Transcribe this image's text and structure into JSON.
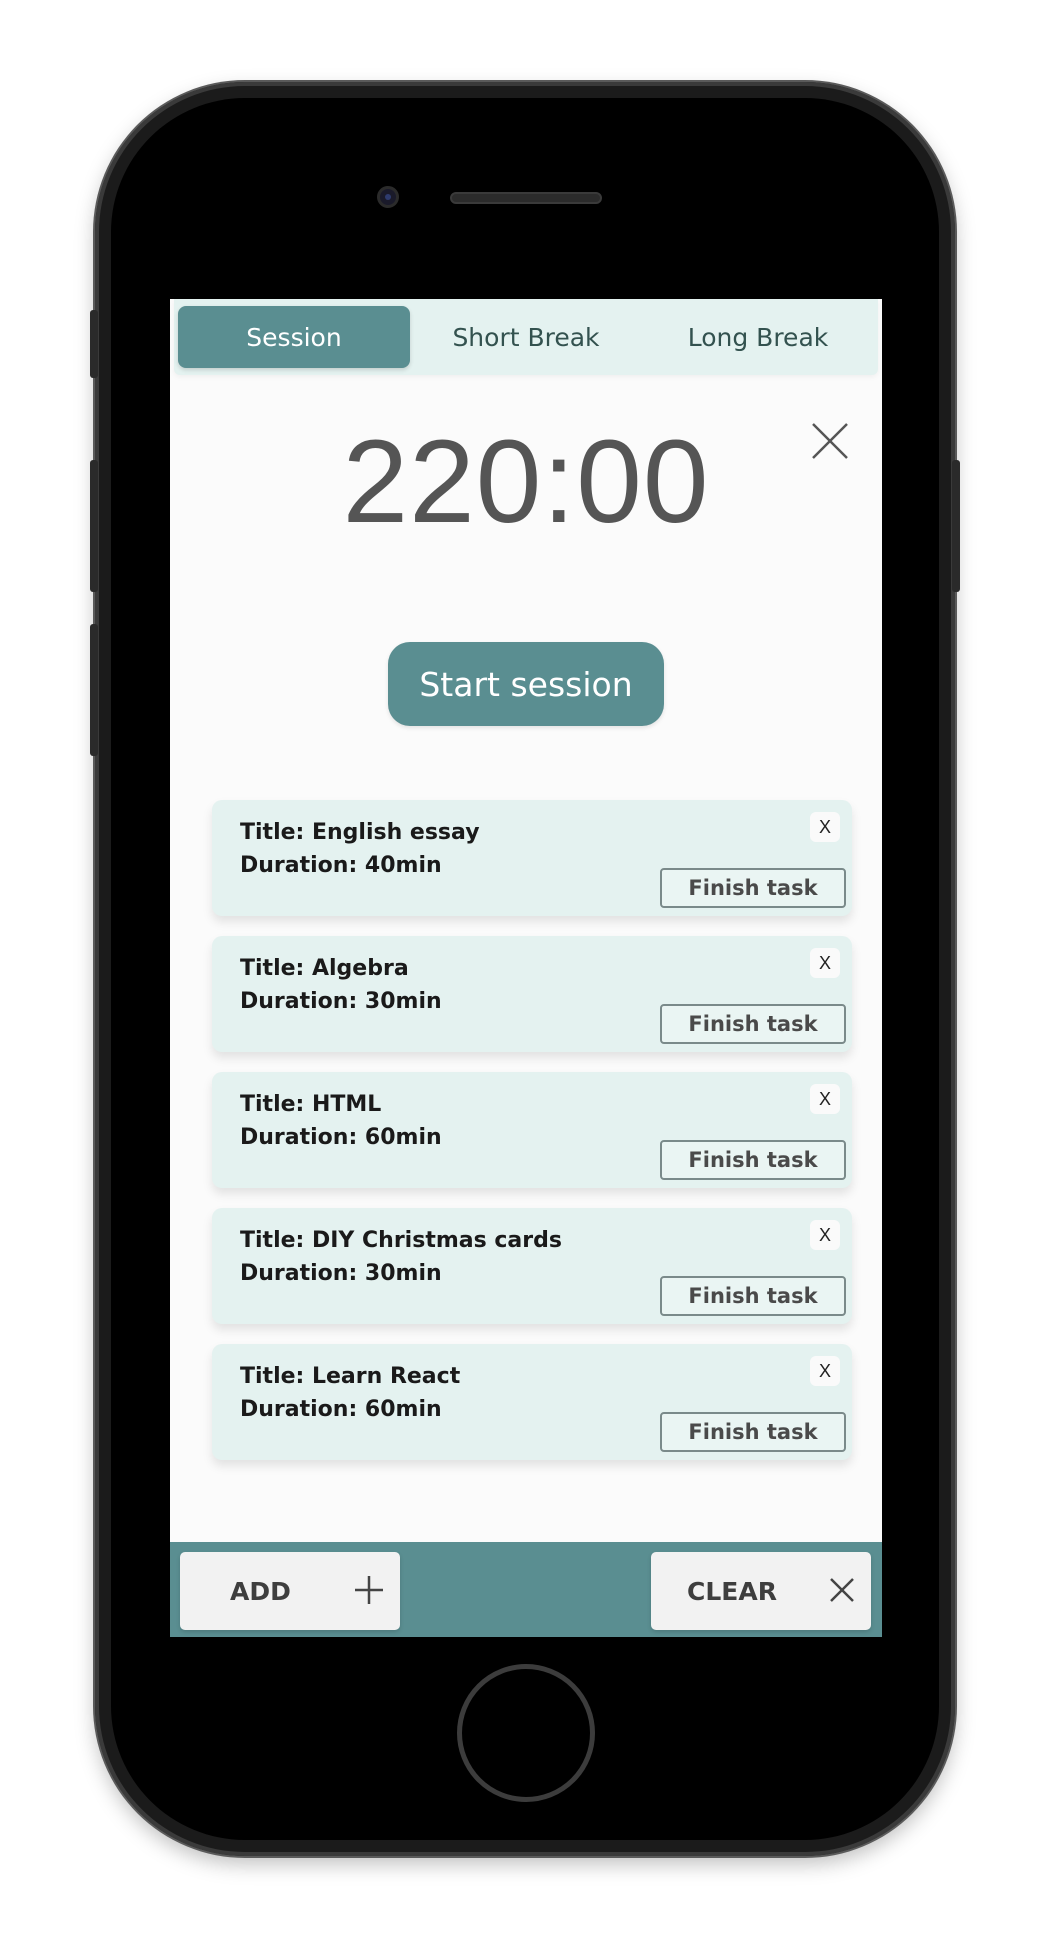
{
  "tabs": [
    {
      "label": "Session",
      "active": true
    },
    {
      "label": "Short Break",
      "active": false
    },
    {
      "label": "Long Break",
      "active": false
    }
  ],
  "timer": {
    "display": "220:00"
  },
  "start_button": {
    "label": "Start session"
  },
  "tasks": [
    {
      "title": "Title: English essay",
      "duration": "Duration: 40min",
      "remove_label": "X",
      "finish_label": "Finish task"
    },
    {
      "title": "Title: Algebra",
      "duration": "Duration: 30min",
      "remove_label": "X",
      "finish_label": "Finish task"
    },
    {
      "title": "Title: HTML",
      "duration": "Duration: 60min",
      "remove_label": "X",
      "finish_label": "Finish task"
    },
    {
      "title": "Title: DIY Christmas cards",
      "duration": "Duration: 30min",
      "remove_label": "X",
      "finish_label": "Finish task"
    },
    {
      "title": "Title: Learn React",
      "duration": "Duration: 60min",
      "remove_label": "X",
      "finish_label": "Finish task"
    }
  ],
  "bottom_bar": {
    "add_label": "ADD",
    "add_icon": "plus-icon",
    "clear_label": "CLEAR",
    "clear_icon": "close-icon"
  },
  "colors": {
    "accent": "#5a8e91",
    "card_background": "#e4f2f0",
    "timer_text": "#555555"
  }
}
